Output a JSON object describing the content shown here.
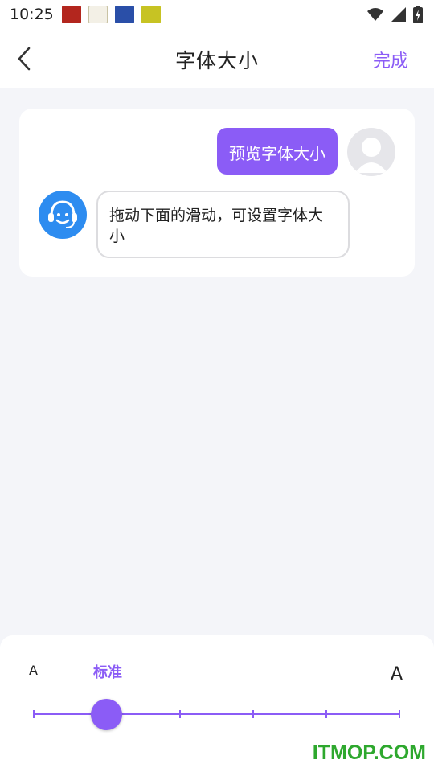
{
  "status_bar": {
    "time": "10:25",
    "notification_icons": [
      "app-icon-red",
      "app-icon-yk",
      "app-icon-blue",
      "app-icon-green"
    ]
  },
  "nav": {
    "title": "字体大小",
    "done_label": "完成",
    "back_icon": "chevron-left-icon"
  },
  "chat": {
    "user_message": "预览字体大小",
    "bot_message": "拖动下面的滑动，可设置字体大小"
  },
  "font_size": {
    "small_label": "A",
    "standard_label": "标准",
    "large_label": "A",
    "steps": 6,
    "selected_index": 1
  },
  "watermark": "ITMOP.COM",
  "colors": {
    "accent": "#8b5cf6",
    "bot_avatar": "#2d8cf0",
    "background": "#f4f5f9"
  }
}
